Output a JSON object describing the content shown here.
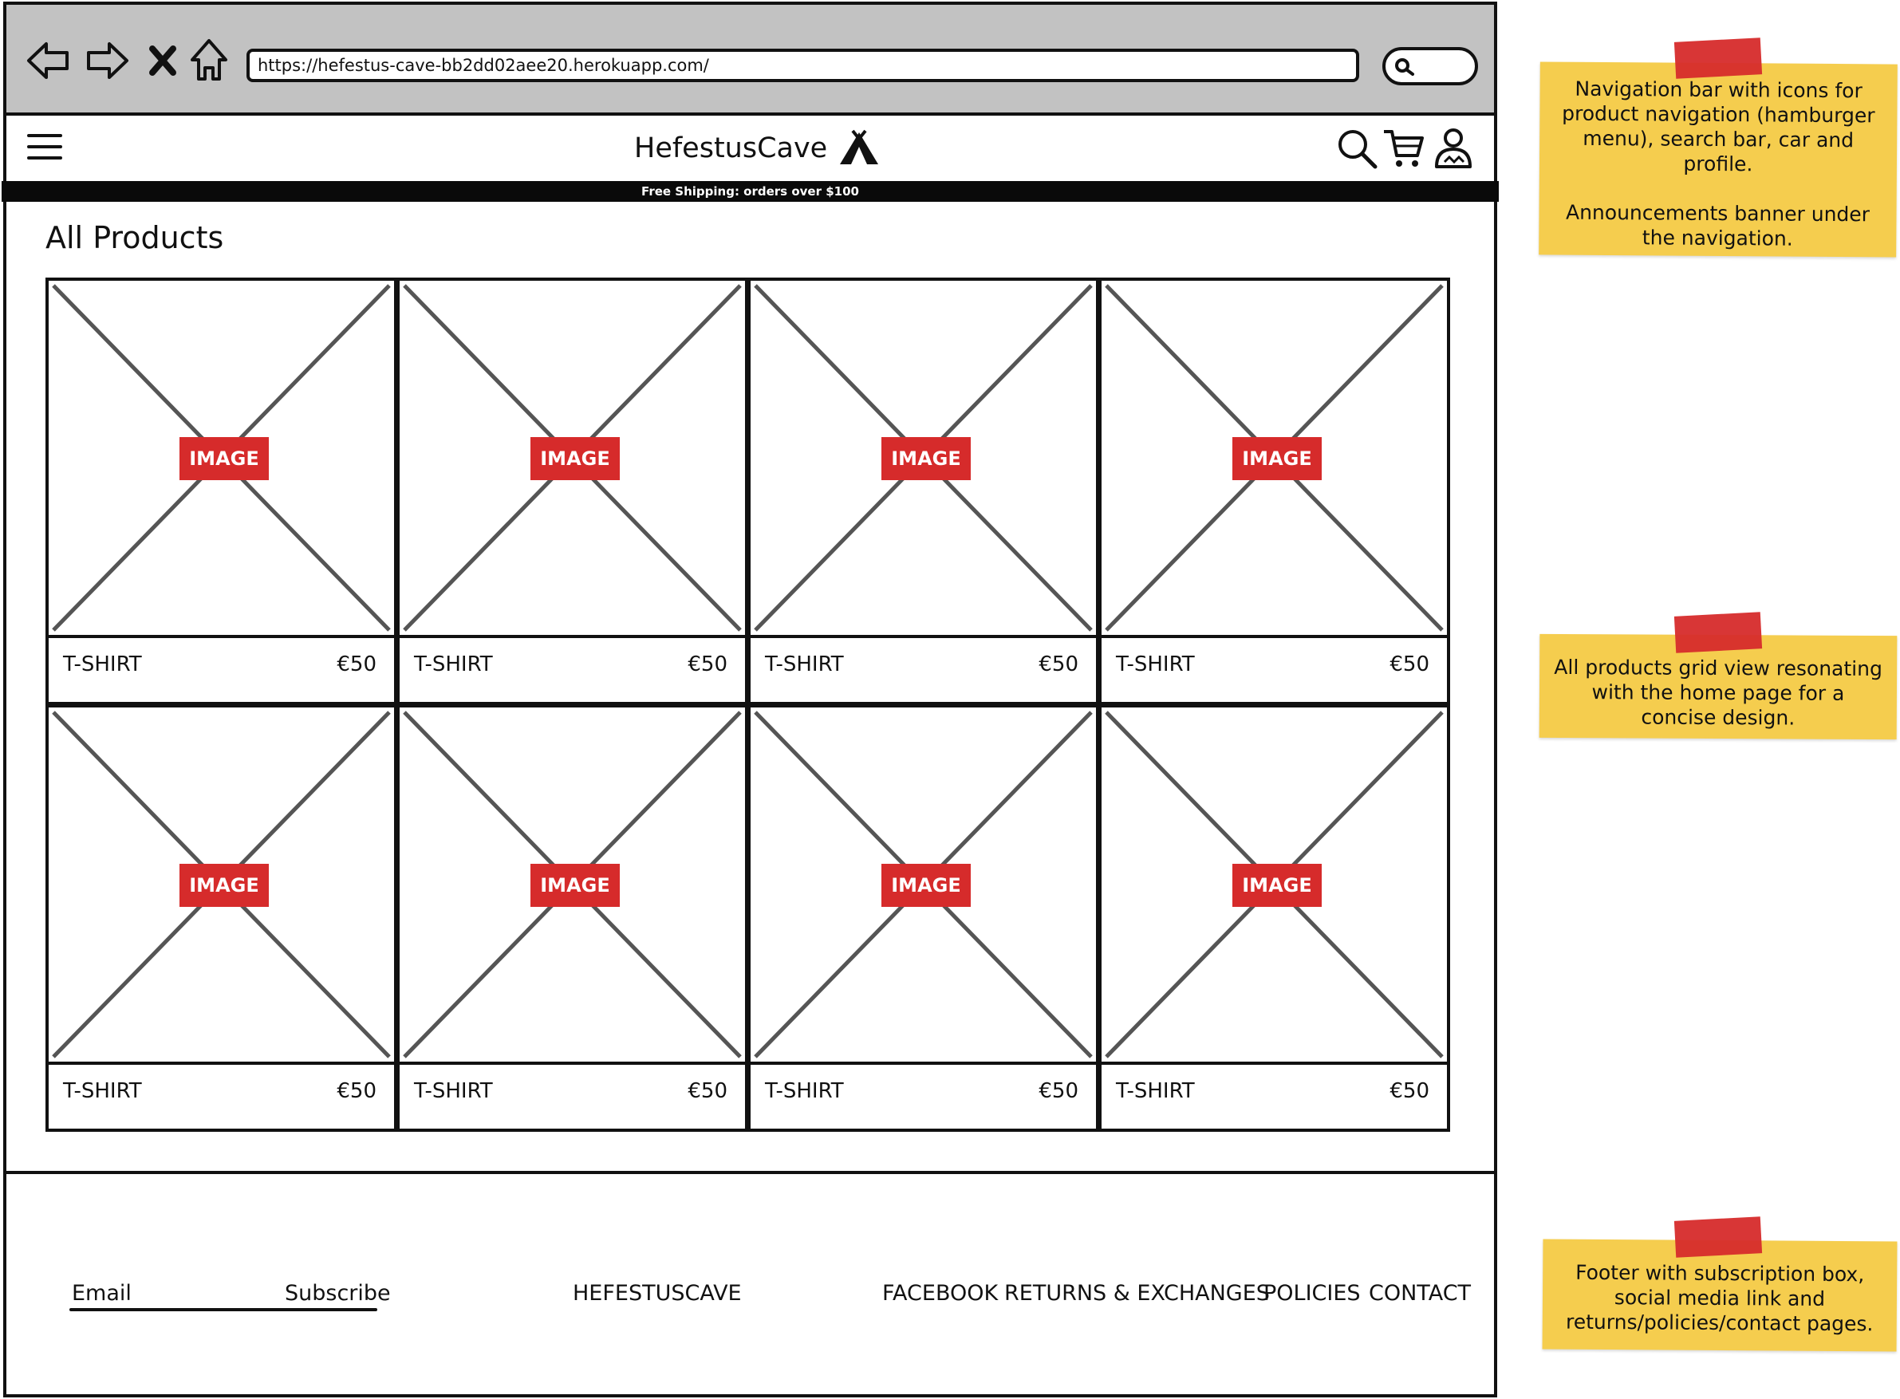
{
  "browser": {
    "url": "https://hefestus-cave-bb2dd02aee20.herokuapp.com/",
    "icons": [
      "back-arrow-icon",
      "forward-arrow-icon",
      "close-icon",
      "home-icon",
      "search-icon"
    ]
  },
  "header": {
    "menu_icon": "hamburger-icon",
    "brand": "HefestusCave",
    "brand_logo": "tent-icon",
    "icons": [
      "search-icon",
      "cart-icon",
      "profile-icon"
    ],
    "announcement": "Free Shipping: orders over $100"
  },
  "main": {
    "title": "All Products",
    "products": [
      {
        "image_label": "IMAGE",
        "name": "T-SHIRT",
        "price": "€50"
      },
      {
        "image_label": "IMAGE",
        "name": "T-SHIRT",
        "price": "€50"
      },
      {
        "image_label": "IMAGE",
        "name": "T-SHIRT",
        "price": "€50"
      },
      {
        "image_label": "IMAGE",
        "name": "T-SHIRT",
        "price": "€50"
      },
      {
        "image_label": "IMAGE",
        "name": "T-SHIRT",
        "price": "€50"
      },
      {
        "image_label": "IMAGE",
        "name": "T-SHIRT",
        "price": "€50"
      },
      {
        "image_label": "IMAGE",
        "name": "T-SHIRT",
        "price": "€50"
      },
      {
        "image_label": "IMAGE",
        "name": "T-SHIRT",
        "price": "€50"
      }
    ]
  },
  "footer": {
    "email_placeholder": "Email",
    "subscribe": "Subscribe",
    "brand": "HEFESTUSCAVE",
    "links": [
      "FACEBOOK",
      "RETURNS & EXCHANGES",
      "POLICIES",
      "CONTACT"
    ]
  },
  "notes": [
    {
      "paragraphs": [
        "Navigation bar with icons for product navigation (hamburger menu), search bar, car and profile.",
        "Announcements banner under the navigation."
      ]
    },
    {
      "paragraphs": [
        "All products grid view resonating with the home page for a concise design."
      ]
    },
    {
      "paragraphs": [
        "Footer with subscription box, social media link and returns/policies/contact pages."
      ]
    }
  ],
  "colors": {
    "chrome": "#c2c2c2",
    "image_tag": "#d62b2b",
    "note": "#f5cd4e",
    "tape": "#d62b2b",
    "banner": "#0a0a0a"
  }
}
